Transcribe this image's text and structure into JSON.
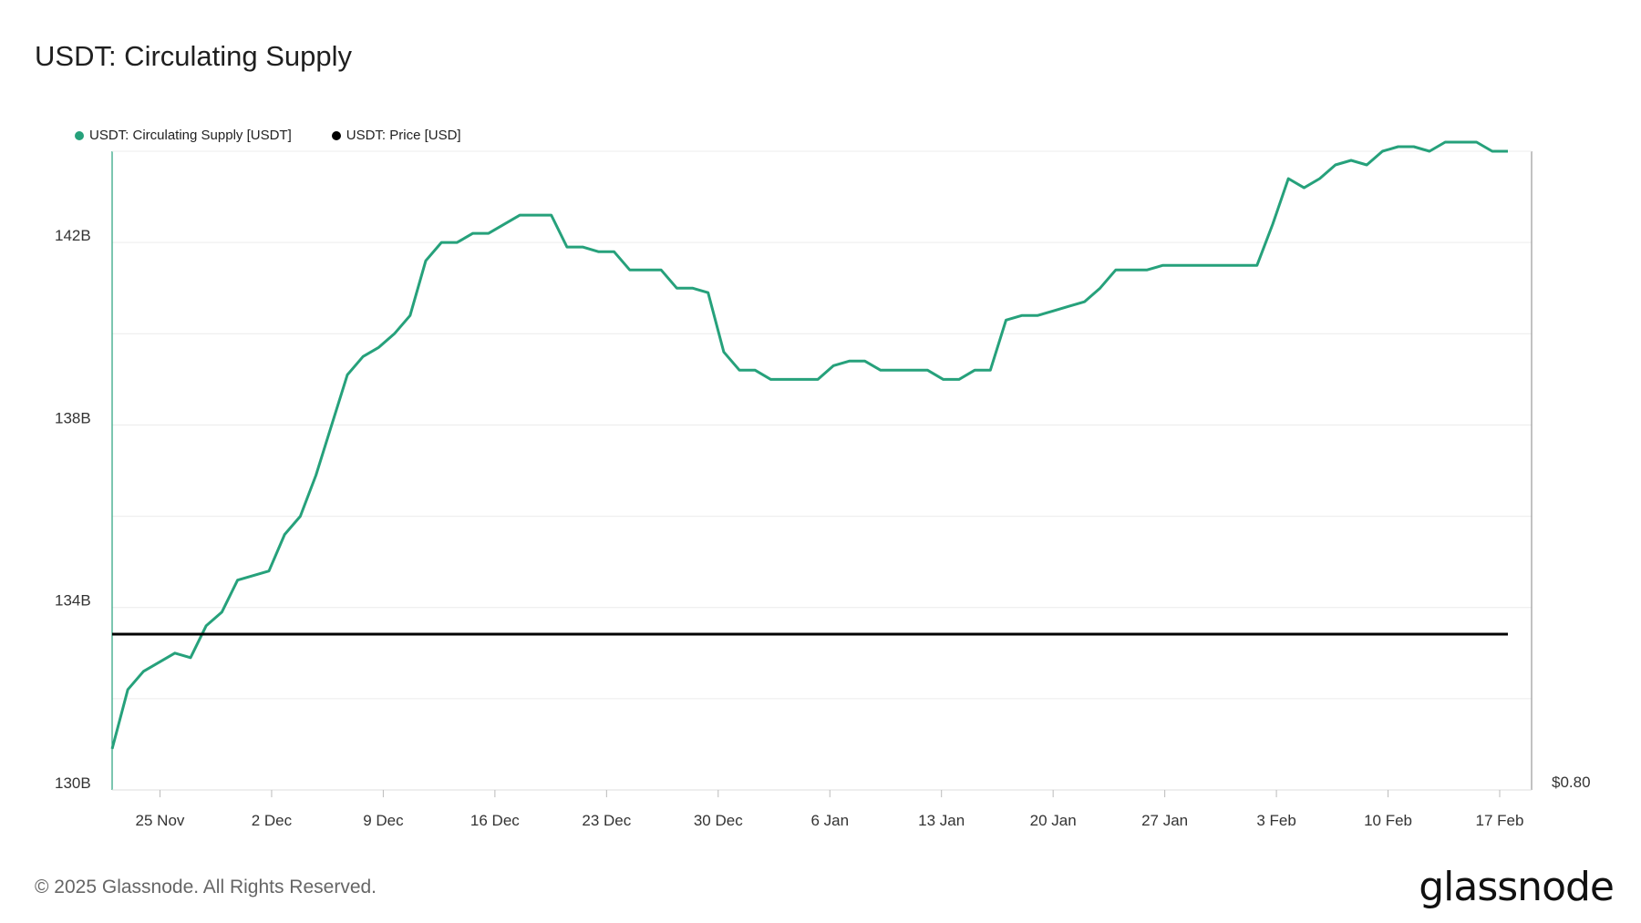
{
  "chart_data": {
    "type": "line",
    "title": "USDT: Circulating Supply",
    "x_ticks": [
      "25 Nov",
      "2 Dec",
      "9 Dec",
      "16 Dec",
      "23 Dec",
      "30 Dec",
      "6 Jan",
      "13 Jan",
      "20 Jan",
      "27 Jan",
      "3 Feb",
      "10 Feb",
      "17 Feb"
    ],
    "x_start": "2024-11-22",
    "x_end": "2025-02-19",
    "y_left": {
      "ticks": [
        "130B",
        "134B",
        "138B",
        "142B"
      ],
      "range_billions": [
        130,
        144
      ]
    },
    "y_right": {
      "ticks": [
        "$0.80"
      ]
    },
    "legend_position": "top-left",
    "grid": "horizontal",
    "series": [
      {
        "name": "USDT: Circulating Supply [USDT]",
        "color": "#26a17b",
        "axis": "left",
        "unit": "billions",
        "values": [
          130.9,
          132.2,
          132.6,
          132.8,
          133.0,
          132.9,
          133.6,
          133.9,
          134.6,
          134.7,
          134.8,
          135.6,
          136.0,
          136.9,
          138.0,
          139.1,
          139.5,
          139.7,
          140.0,
          140.4,
          141.6,
          142.0,
          142.0,
          142.2,
          142.2,
          142.4,
          142.6,
          142.6,
          142.6,
          141.9,
          141.9,
          141.8,
          141.8,
          141.4,
          141.4,
          141.4,
          141.0,
          141.0,
          140.9,
          139.6,
          139.2,
          139.2,
          139.0,
          139.0,
          139.0,
          139.0,
          139.3,
          139.4,
          139.4,
          139.2,
          139.2,
          139.2,
          139.2,
          139.0,
          139.0,
          139.2,
          139.2,
          140.3,
          140.4,
          140.4,
          140.5,
          140.6,
          140.7,
          141.0,
          141.4,
          141.4,
          141.4,
          141.5,
          141.5,
          141.5,
          141.5,
          141.5,
          141.5,
          141.5,
          142.4,
          143.4,
          143.2,
          143.4,
          143.7,
          143.8,
          143.7,
          144.0,
          144.1,
          144.1,
          144.0,
          144.2,
          144.2,
          144.2,
          144.0,
          144.0
        ]
      },
      {
        "name": "USDT: Price [USD]",
        "color": "#000000",
        "axis": "right",
        "unit": "USD",
        "values": [
          1.0,
          1.0,
          1.0,
          1.0,
          1.0,
          1.0,
          1.0,
          1.0,
          1.0,
          1.0,
          1.0,
          1.0,
          1.0,
          1.0,
          1.0,
          1.0,
          1.0,
          1.0,
          1.0,
          1.0,
          1.0,
          1.0,
          1.0,
          1.0,
          1.0,
          1.0,
          1.0,
          1.0,
          1.0,
          1.0,
          1.0,
          1.0,
          1.0,
          1.0,
          1.0,
          1.0,
          1.0,
          1.0,
          1.0,
          1.0,
          1.0,
          1.0,
          1.0,
          1.0,
          1.0,
          1.0,
          1.0,
          1.0,
          1.0,
          1.0,
          1.0,
          1.0,
          1.0,
          1.0,
          1.0,
          1.0,
          1.0,
          1.0,
          1.0,
          1.0,
          1.0,
          1.0,
          1.0,
          1.0,
          1.0,
          1.0,
          1.0,
          1.0,
          1.0,
          1.0,
          1.0,
          1.0,
          1.0,
          1.0,
          1.0,
          1.0,
          1.0,
          1.0,
          1.0,
          1.0,
          1.0,
          1.0,
          1.0,
          1.0,
          1.0,
          1.0,
          1.0,
          1.0,
          1.0
        ]
      }
    ]
  },
  "footer": {
    "copyright": "© 2025 Glassnode. All Rights Reserved.",
    "logo": "glassnode"
  }
}
